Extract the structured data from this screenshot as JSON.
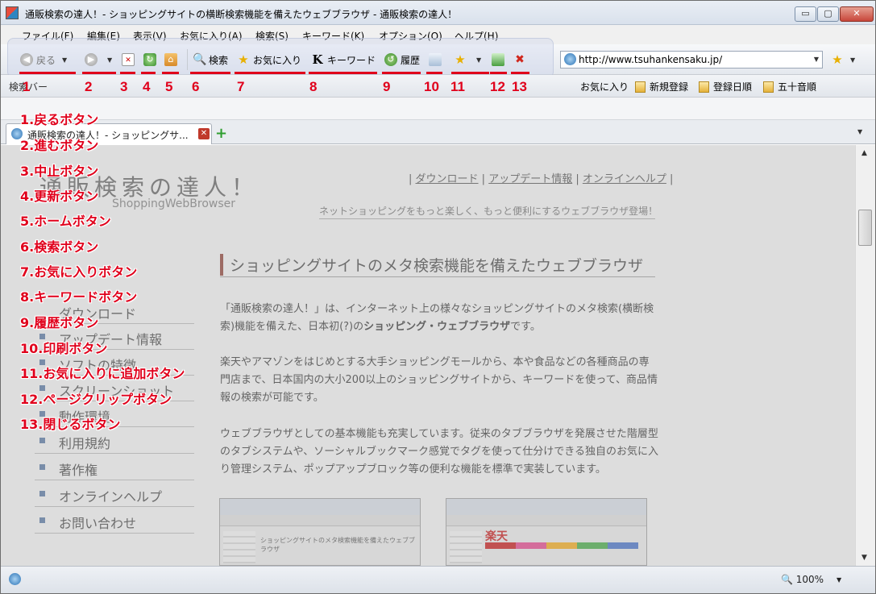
{
  "window": {
    "title": "通販検索の達人！- ショッピングサイトの横断検索機能を備えたウェブブラウザ - 通販検索の達人！",
    "min_label": "▭",
    "max_label": "▢",
    "close_label": "✕"
  },
  "menu": [
    "ファイル(F)",
    "編集(E)",
    "表示(V)",
    "お気に入り(A)",
    "検索(S)",
    "キーワード(K)",
    "オプション(O)",
    "ヘルプ(H)"
  ],
  "toolbar": {
    "back_label": "戻る",
    "search_label": "検索",
    "favorites_label": "お気に入り",
    "keyword_label": "キーワード",
    "history_label": "履歴"
  },
  "address": {
    "url": "http://www.tsuhankensaku.jp/"
  },
  "bars": {
    "left_label": "検索バー"
  },
  "favbar": [
    "お気に入り",
    "新規登録",
    "登録日順",
    "五十音順"
  ],
  "tab": {
    "title": "通販検索の達人！- ショッピングサ..."
  },
  "status": {
    "zoom": "100%"
  },
  "page": {
    "logo": "通販検索の達人！",
    "logo_sub": "ShoppingWebBrowser",
    "links": [
      "ダウンロード",
      "アップデート情報",
      "オンラインヘルプ"
    ],
    "tagline": "ネットショッピングをもっと楽しく、もっと便利にするウェブブラウザ登場！",
    "section_title": "ショッピングサイトのメタ検索機能を備えたウェブブラウザ",
    "para1_pre": "「通販検索の達人！」は、インターネット上の様々なショッピングサイトのメタ検索(横断検索)機能を備えた、日本初(?)の",
    "para1_bold": "ショッピング・ウェブブラウザ",
    "para1_post": "です。",
    "para2": "楽天やアマゾンをはじめとする大手ショッピングモールから、本や食品などの各種商品の専門店まで、日本国内の大小200以上のショッピングサイトから、キーワードを使って、商品情報の検索が可能です。",
    "para3": "ウェブブラウザとしての基本機能も充実しています。従来のタブブラウザを発展させた階層型のタブシステムや、ソーシャルブックマーク感覚でタグを使って仕分けできる独自のお気に入り管理システム、ポップアップブロック等の便利な機能を標準で実装しています。",
    "side_menu": [
      "ダウンロード",
      "アップデート情報",
      "ソフトの特徴",
      "スクリーンショット",
      "動作環境",
      "利用規約",
      "著作権",
      "オンラインヘルプ",
      "お問い合わせ"
    ],
    "shot1_text": "ショッピングサイトのメタ検索機能を備えたウェブブラウザ",
    "shot2_logo": "楽天"
  },
  "annotations": {
    "numbers": [
      "1",
      "2",
      "3",
      "4",
      "5",
      "6",
      "7",
      "8",
      "9",
      "10",
      "11",
      "12",
      "13"
    ],
    "labels": [
      "1.戻るボタン",
      "2.進むボタン",
      "3.中止ボタン",
      "4.更新ボタン",
      "5.ホームボタン",
      "6.検索ボタン",
      "7.お気に入りボタン",
      "8.キーワードボタン",
      "9.履歴ボタン",
      "10.印刷ボタン",
      "11.お気に入りに追加ボタン",
      "12.ページクリップボタン",
      "13.閉じるボタン"
    ]
  },
  "colors": {
    "annotation": "#e0001b",
    "title_accent": "#8a3024"
  }
}
